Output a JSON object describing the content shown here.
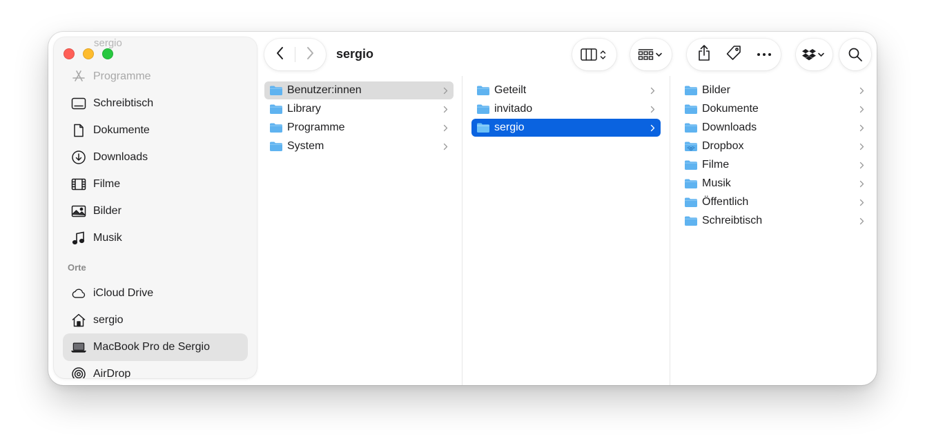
{
  "window": {
    "title": "sergio"
  },
  "sidebar": {
    "ghost_title": "sergio",
    "partial_item": {
      "label": "Programme",
      "icon": "apps-icon"
    },
    "favorites": [
      {
        "label": "Schreibtisch",
        "icon": "desktop-icon"
      },
      {
        "label": "Dokumente",
        "icon": "document-icon"
      },
      {
        "label": "Downloads",
        "icon": "download-icon"
      },
      {
        "label": "Filme",
        "icon": "film-icon"
      },
      {
        "label": "Bilder",
        "icon": "photo-icon"
      },
      {
        "label": "Musik",
        "icon": "music-icon"
      }
    ],
    "locations_header": "Orte",
    "locations": [
      {
        "label": "iCloud Drive",
        "icon": "cloud-icon"
      },
      {
        "label": "sergio",
        "icon": "home-icon"
      },
      {
        "label": "MacBook Pro de Sergio",
        "icon": "laptop-icon",
        "active": true
      },
      {
        "label": "AirDrop",
        "icon": "airdrop-icon"
      }
    ]
  },
  "toolbar": {
    "back_icon": "chevron-left-icon",
    "forward_icon": "chevron-right-icon",
    "view_icon": "columns-view-icon",
    "group_icon": "grid-group-icon",
    "share_icon": "share-icon",
    "tag_icon": "tag-icon",
    "more_icon": "ellipsis-icon",
    "dropbox_icon": "dropbox-icon",
    "search_icon": "search-icon"
  },
  "columns": [
    {
      "items": [
        {
          "label": "Benutzer:innen",
          "state": "gray"
        },
        {
          "label": "Library"
        },
        {
          "label": "Programme"
        },
        {
          "label": "System"
        }
      ]
    },
    {
      "items": [
        {
          "label": "Geteilt"
        },
        {
          "label": "invitado"
        },
        {
          "label": "sergio",
          "state": "blue"
        }
      ]
    },
    {
      "items": [
        {
          "label": "Bilder"
        },
        {
          "label": "Dokumente"
        },
        {
          "label": "Downloads"
        },
        {
          "label": "Dropbox",
          "special": "dropbox"
        },
        {
          "label": "Filme"
        },
        {
          "label": "Musik"
        },
        {
          "label": "Öffentlich"
        },
        {
          "label": "Schreibtisch"
        }
      ]
    }
  ],
  "colors": {
    "accent": "#0a63e0",
    "folder": "#5fb3f0",
    "folder_tab": "#8cc9f5",
    "sidebar_bg": "#f6f6f6",
    "selection_gray": "#dcdcdc"
  }
}
